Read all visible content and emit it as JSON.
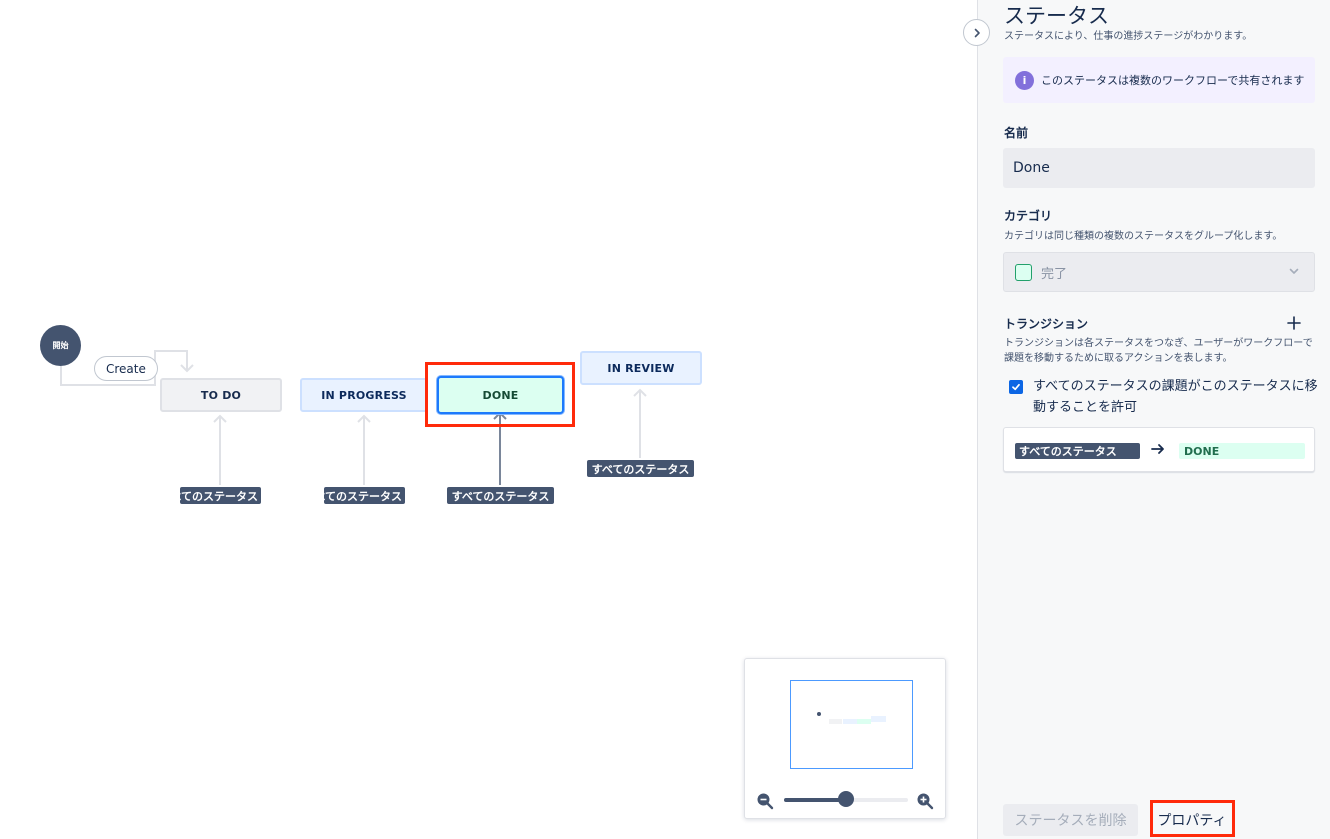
{
  "workflow": {
    "start_label": "開始",
    "create_label": "Create",
    "statuses": [
      {
        "label": "TO DO"
      },
      {
        "label": "IN PROGRESS"
      },
      {
        "label": "DONE"
      },
      {
        "label": "IN REVIEW"
      }
    ],
    "all_statuses_badges": [
      {
        "label": "すべてのステータス"
      },
      {
        "label": "すべてのステータス"
      },
      {
        "label": "すべてのステータス"
      },
      {
        "label": "すべてのステータス"
      }
    ]
  },
  "minimap": {
    "zoom_level": 0.5
  },
  "panel": {
    "title": "ステータス",
    "subtitle": "ステータスにより、仕事の進捗ステージがわかります。",
    "info_text": "このステータスは複数のワークフローで共有されます",
    "name_label": "名前",
    "name_value": "Done",
    "category_label": "カテゴリ",
    "category_desc": "カテゴリは同じ種類の複数のステータスをグループ化します。",
    "category_value": "完了",
    "transition_label": "トランジション",
    "transition_desc": "トランジションは各ステータスをつなぎ、ユーザーがワークフローで課題を移動するために取るアクションを表します。",
    "allow_all_label": "すべてのステータスの課題がこのステータスに移動することを許可",
    "allow_all_checked": true,
    "transition_from": "すべてのステータス",
    "transition_to": "DONE",
    "delete_button": "ステータスを削除",
    "properties_button": "プロパティ"
  },
  "colors": {
    "highlight": "#ff2a0a",
    "done_fill": "#dcfff1",
    "in_progress_fill": "#e9f2ff",
    "todo_fill": "#f1f2f4",
    "badge_dark": "#44546f"
  }
}
